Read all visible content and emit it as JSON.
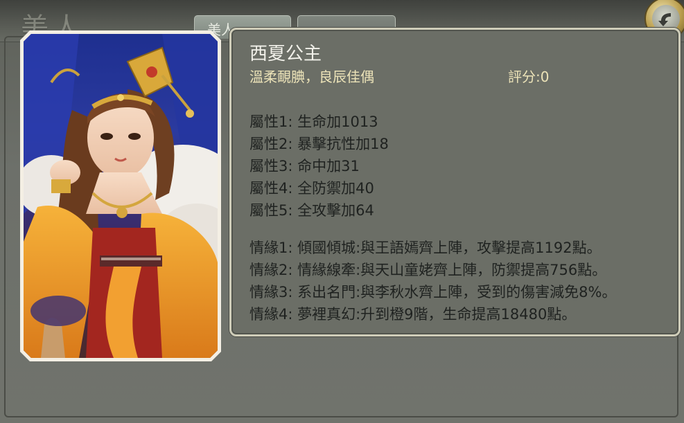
{
  "window": {
    "title": "美人"
  },
  "tabs": [
    {
      "label": "美人"
    },
    {
      "label": ""
    }
  ],
  "back_button": {
    "icon": "back-arrow-icon"
  },
  "beauty": {
    "name": "西夏公主",
    "subtitle": "溫柔靦腆，良辰佳偶",
    "score": "評分:0",
    "attributes": [
      "屬性1: 生命加1013",
      "屬性2: 暴擊抗性加18",
      "屬性3: 命中加31",
      "屬性4: 全防禦加40",
      "屬性5: 全攻擊加64"
    ],
    "bonds": [
      "情緣1: 傾國傾城:與王語嫣齊上陣，攻擊提高1192點。",
      "情緣2: 情緣線牽:與天山童姥齊上陣，防禦提高756點。",
      "情緣3: 系出名門:與李秋水齊上陣，受到的傷害減免8%。",
      "情緣4: 夢裡真幻:升到橙9階，生命提高18480點。"
    ]
  },
  "colors": {
    "panel_bg": "#6b6e66",
    "panel_border": "#cfcdb9",
    "name_text": "#f2f1ea",
    "subtitle_text": "#ece3b8",
    "body_text": "#1f2220"
  }
}
